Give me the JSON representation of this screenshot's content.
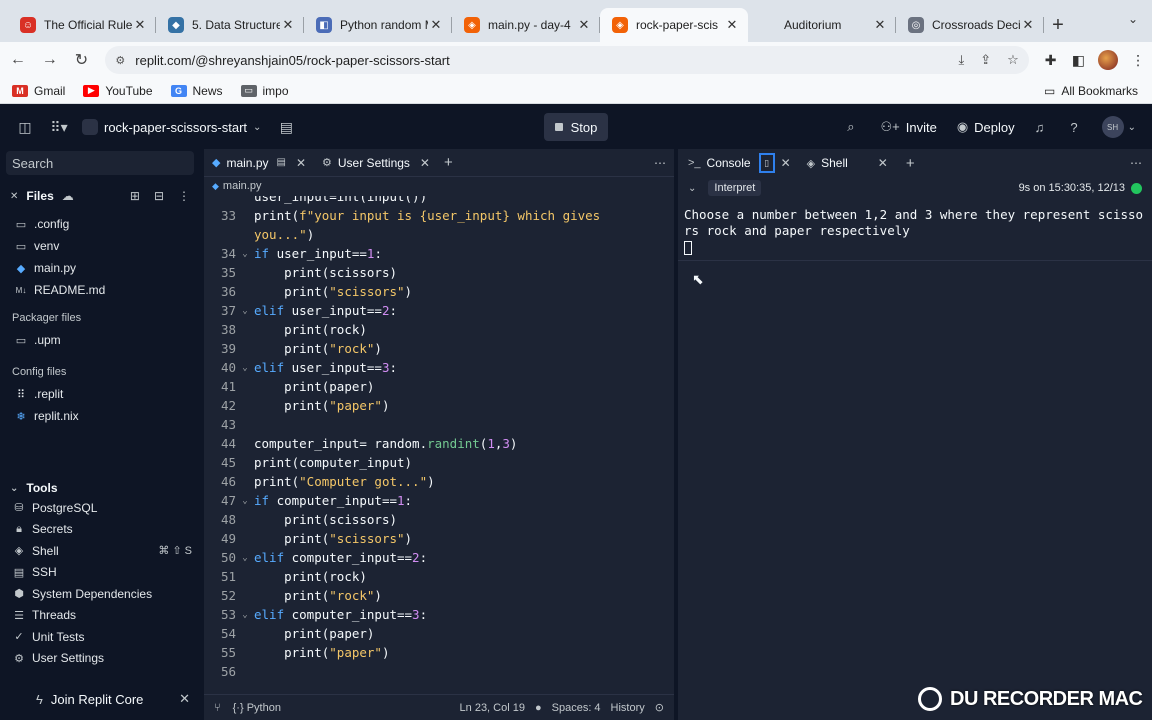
{
  "browser": {
    "tabs": [
      {
        "label": "The Official Rule",
        "fav_color": "#d93025",
        "fav_glyph": "☺"
      },
      {
        "label": "5. Data Structure",
        "fav_color": "#3572A5",
        "fav_glyph": "◆"
      },
      {
        "label": "Python random M",
        "fav_color": "#4b6cb7",
        "fav_glyph": "◧"
      },
      {
        "label": "main.py - day-4",
        "fav_color": "#f26207",
        "fav_glyph": "◈"
      },
      {
        "label": "rock-paper-scis",
        "fav_color": "#f26207",
        "fav_glyph": "◈",
        "active": true
      },
      {
        "label": "Auditorium",
        "fav_color": "#dde3ea",
        "fav_glyph": ""
      },
      {
        "label": "Crossroads Deci",
        "fav_color": "#6b7280",
        "fav_glyph": "◎"
      }
    ],
    "url": "replit.com/@shreyanshjain05/rock-paper-scissors-start",
    "bookmarks": [
      {
        "label": "Gmail",
        "color": "#d93025",
        "glyph": "M"
      },
      {
        "label": "YouTube",
        "color": "#ff0000",
        "glyph": "▶"
      },
      {
        "label": "News",
        "color": "#4285f4",
        "glyph": "G"
      },
      {
        "label": "impo",
        "color": "#5f6368",
        "glyph": "▭"
      }
    ],
    "all_bookmarks": "All Bookmarks"
  },
  "header": {
    "repl_name": "rock-paper-scissors-start",
    "stop_label": "Stop",
    "invite_label": "Invite",
    "deploy_label": "Deploy",
    "avatar_initials": "SH"
  },
  "sidebar": {
    "search_placeholder": "Search",
    "files_title": "Files",
    "files": [
      {
        "name": ".config",
        "icon": "folder-icon"
      },
      {
        "name": "venv",
        "icon": "folder-icon"
      },
      {
        "name": "main.py",
        "icon": "python-icon"
      },
      {
        "name": "README.md",
        "icon": "markdown-icon"
      }
    ],
    "packager_label": "Packager files",
    "packager_files": [
      {
        "name": ".upm",
        "icon": "folder-icon"
      }
    ],
    "config_label": "Config files",
    "config_files": [
      {
        "name": ".replit",
        "icon": "replit-icon"
      },
      {
        "name": "replit.nix",
        "icon": "nix-icon"
      }
    ],
    "tools_title": "Tools",
    "tools": [
      {
        "name": "PostgreSQL",
        "icon": "database-icon"
      },
      {
        "name": "Secrets",
        "icon": "lock-icon"
      },
      {
        "name": "Shell",
        "icon": "shell-icon",
        "shortcut": "⌘ ⇧ S"
      },
      {
        "name": "SSH",
        "icon": "terminal-icon"
      },
      {
        "name": "System Dependencies",
        "icon": "cube-icon"
      },
      {
        "name": "Threads",
        "icon": "threads-icon"
      },
      {
        "name": "Unit Tests",
        "icon": "check-icon"
      },
      {
        "name": "User Settings",
        "icon": "gear-icon"
      }
    ],
    "join_core": "Join Replit Core"
  },
  "editor": {
    "tabs": [
      {
        "label": "main.py"
      },
      {
        "label": "User Settings"
      }
    ],
    "breadcrumb": "main.py",
    "first_visible_line": 32,
    "lines": [
      {
        "n": "",
        "fold": false,
        "indent": 0,
        "tokens": [
          {
            "t": "user_input=int(input())",
            "c": "fn"
          }
        ],
        "partial": true
      },
      {
        "n": "33",
        "fold": false,
        "indent": 0,
        "tokens": [
          {
            "t": "print",
            "c": "fn"
          },
          {
            "t": "(",
            "c": "fn"
          },
          {
            "t": "f\"your input is {user_input} which gives",
            "c": "str"
          }
        ]
      },
      {
        "n": "",
        "fold": false,
        "indent": 0,
        "tokens": [
          {
            "t": "you...\"",
            "c": "str"
          },
          {
            "t": ")",
            "c": "fn"
          }
        ]
      },
      {
        "n": "34",
        "fold": true,
        "indent": 0,
        "tokens": [
          {
            "t": "if",
            "c": "kw"
          },
          {
            "t": " user_input==",
            "c": "fn"
          },
          {
            "t": "1",
            "c": "num"
          },
          {
            "t": ":",
            "c": "fn"
          }
        ]
      },
      {
        "n": "35",
        "fold": false,
        "indent": 1,
        "tokens": [
          {
            "t": "print(scissors)",
            "c": "fn"
          }
        ]
      },
      {
        "n": "36",
        "fold": false,
        "indent": 1,
        "tokens": [
          {
            "t": "print(",
            "c": "fn"
          },
          {
            "t": "\"scissors\"",
            "c": "str"
          },
          {
            "t": ")",
            "c": "fn"
          }
        ]
      },
      {
        "n": "37",
        "fold": true,
        "indent": 0,
        "tokens": [
          {
            "t": "elif",
            "c": "kw"
          },
          {
            "t": " user_input==",
            "c": "fn"
          },
          {
            "t": "2",
            "c": "num"
          },
          {
            "t": ":",
            "c": "fn"
          }
        ]
      },
      {
        "n": "38",
        "fold": false,
        "indent": 1,
        "tokens": [
          {
            "t": "print(rock)",
            "c": "fn"
          }
        ]
      },
      {
        "n": "39",
        "fold": false,
        "indent": 1,
        "tokens": [
          {
            "t": "print(",
            "c": "fn"
          },
          {
            "t": "\"rock\"",
            "c": "str"
          },
          {
            "t": ")",
            "c": "fn"
          }
        ]
      },
      {
        "n": "40",
        "fold": true,
        "indent": 0,
        "tokens": [
          {
            "t": "elif",
            "c": "kw"
          },
          {
            "t": " user_input==",
            "c": "fn"
          },
          {
            "t": "3",
            "c": "num"
          },
          {
            "t": ":",
            "c": "fn"
          }
        ]
      },
      {
        "n": "41",
        "fold": false,
        "indent": 1,
        "tokens": [
          {
            "t": "print(paper)",
            "c": "fn"
          }
        ]
      },
      {
        "n": "42",
        "fold": false,
        "indent": 1,
        "tokens": [
          {
            "t": "print(",
            "c": "fn"
          },
          {
            "t": "\"paper\"",
            "c": "str"
          },
          {
            "t": ")",
            "c": "fn"
          }
        ]
      },
      {
        "n": "43",
        "fold": false,
        "indent": 0,
        "tokens": []
      },
      {
        "n": "44",
        "fold": false,
        "indent": 0,
        "tokens": [
          {
            "t": "computer_input= random.",
            "c": "fn"
          },
          {
            "t": "randint",
            "c": "mod"
          },
          {
            "t": "(",
            "c": "fn"
          },
          {
            "t": "1",
            "c": "num"
          },
          {
            "t": ",",
            "c": "fn"
          },
          {
            "t": "3",
            "c": "num"
          },
          {
            "t": ")",
            "c": "fn"
          }
        ]
      },
      {
        "n": "45",
        "fold": false,
        "indent": 0,
        "tokens": [
          {
            "t": "print(computer_input)",
            "c": "fn"
          }
        ]
      },
      {
        "n": "46",
        "fold": false,
        "indent": 0,
        "tokens": [
          {
            "t": "print(",
            "c": "fn"
          },
          {
            "t": "\"Computer got...\"",
            "c": "str"
          },
          {
            "t": ")",
            "c": "fn"
          }
        ]
      },
      {
        "n": "47",
        "fold": true,
        "indent": 0,
        "tokens": [
          {
            "t": "if",
            "c": "kw"
          },
          {
            "t": " computer_input==",
            "c": "fn"
          },
          {
            "t": "1",
            "c": "num"
          },
          {
            "t": ":",
            "c": "fn"
          }
        ]
      },
      {
        "n": "48",
        "fold": false,
        "indent": 1,
        "tokens": [
          {
            "t": "print(scissors)",
            "c": "fn"
          }
        ]
      },
      {
        "n": "49",
        "fold": false,
        "indent": 1,
        "tokens": [
          {
            "t": "print(",
            "c": "fn"
          },
          {
            "t": "\"scissors\"",
            "c": "str"
          },
          {
            "t": ")",
            "c": "fn"
          }
        ]
      },
      {
        "n": "50",
        "fold": true,
        "indent": 0,
        "tokens": [
          {
            "t": "elif",
            "c": "kw"
          },
          {
            "t": " computer_input==",
            "c": "fn"
          },
          {
            "t": "2",
            "c": "num"
          },
          {
            "t": ":",
            "c": "fn"
          }
        ]
      },
      {
        "n": "51",
        "fold": false,
        "indent": 1,
        "tokens": [
          {
            "t": "print(rock)",
            "c": "fn"
          }
        ]
      },
      {
        "n": "52",
        "fold": false,
        "indent": 1,
        "tokens": [
          {
            "t": "print(",
            "c": "fn"
          },
          {
            "t": "\"rock\"",
            "c": "str"
          },
          {
            "t": ")",
            "c": "fn"
          }
        ]
      },
      {
        "n": "53",
        "fold": true,
        "indent": 0,
        "tokens": [
          {
            "t": "elif",
            "c": "kw"
          },
          {
            "t": " computer_input==",
            "c": "fn"
          },
          {
            "t": "3",
            "c": "num"
          },
          {
            "t": ":",
            "c": "fn"
          }
        ]
      },
      {
        "n": "54",
        "fold": false,
        "indent": 1,
        "tokens": [
          {
            "t": "print(paper)",
            "c": "fn"
          }
        ]
      },
      {
        "n": "55",
        "fold": false,
        "indent": 1,
        "tokens": [
          {
            "t": "print(",
            "c": "fn"
          },
          {
            "t": "\"paper\"",
            "c": "str"
          },
          {
            "t": ")",
            "c": "fn"
          }
        ]
      },
      {
        "n": "56",
        "fold": false,
        "indent": 0,
        "tokens": []
      }
    ],
    "status": {
      "language": "Python",
      "position": "Ln 23, Col 19",
      "spaces": "Spaces: 4",
      "history": "History"
    }
  },
  "console": {
    "tabs": [
      {
        "label": "Console"
      },
      {
        "label": "Shell"
      }
    ],
    "interpret_label": "Interpret",
    "timestamp": "9s on 15:30:35, 12/13",
    "output": "Choose a number between 1,2 and 3 where they represent scissors rock and paper respectively"
  },
  "watermark": "DU RECORDER MAC"
}
